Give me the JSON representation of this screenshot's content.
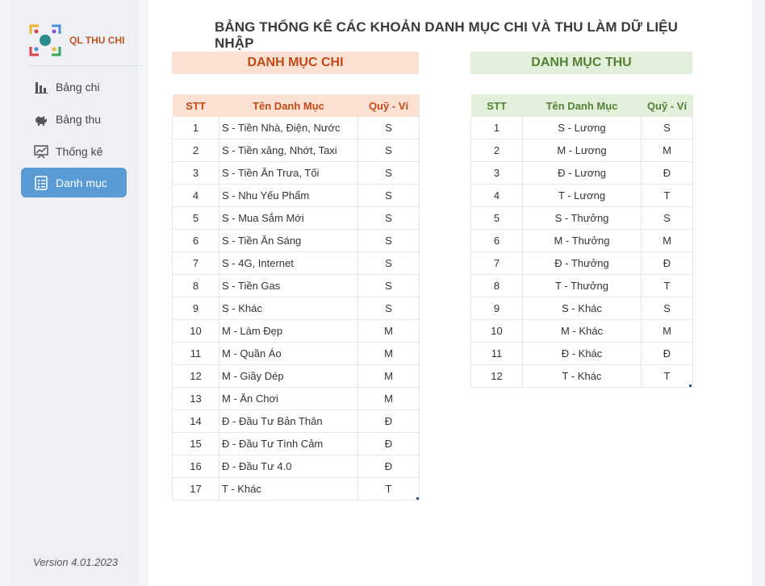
{
  "app": {
    "logo_text": "QL THU CHI",
    "version": "Version 4.01.2023"
  },
  "nav": [
    {
      "label": "Bảng chi",
      "icon": "bar-chart-icon",
      "active": false
    },
    {
      "label": "Bảng thu",
      "icon": "piggy-bank-icon",
      "active": false
    },
    {
      "label": "Thống kê",
      "icon": "presentation-chart-icon",
      "active": false
    },
    {
      "label": "Danh mục",
      "icon": "list-icon",
      "active": true
    }
  ],
  "page_title": "BẢNG THỐNG KÊ CÁC KHOẢN DANH MỤC CHI VÀ THU LÀM DỮ LIỆU NHẬP",
  "chi": {
    "title": "DANH MỤC CHI",
    "headers": [
      "STT",
      "Tên Danh Mục",
      "Quỹ - Ví"
    ],
    "rows": [
      [
        "1",
        "S - Tiền Nhà, Điện, Nước",
        "S"
      ],
      [
        "2",
        "S - Tiền xăng, Nhớt, Taxi",
        "S"
      ],
      [
        "3",
        "S - Tiền Ăn Trưa, Tối",
        "S"
      ],
      [
        "4",
        "S - Nhu Yếu Phẩm",
        "S"
      ],
      [
        "5",
        "S - Mua Sắm Mới",
        "S"
      ],
      [
        "6",
        "S - Tiền Ăn Sáng",
        "S"
      ],
      [
        "7",
        "S - 4G, Internet",
        "S"
      ],
      [
        "8",
        "S - Tiền Gas",
        "S"
      ],
      [
        "9",
        "S - Khác",
        "S"
      ],
      [
        "10",
        "M - Làm Đẹp",
        "M"
      ],
      [
        "11",
        "M - Quần Áo",
        "M"
      ],
      [
        "12",
        "M - Giầy Dép",
        "M"
      ],
      [
        "13",
        "M - Ăn Chơi",
        "M"
      ],
      [
        "14",
        "Đ - Đầu Tư Bản Thân",
        "Đ"
      ],
      [
        "15",
        "Đ - Đầu Tư Tình Cảm",
        "Đ"
      ],
      [
        "16",
        "Đ - Đầu Tư 4.0",
        "Đ"
      ],
      [
        "17",
        "T - Khác",
        "T"
      ]
    ]
  },
  "thu": {
    "title": "DANH MỤC THU",
    "headers": [
      "STT",
      "Tên Danh Mục",
      "Quỹ - Ví"
    ],
    "rows": [
      [
        "1",
        "S - Lương",
        "S"
      ],
      [
        "2",
        "M - Lương",
        "M"
      ],
      [
        "3",
        "Đ - Lương",
        "Đ"
      ],
      [
        "4",
        "T - Lương",
        "T"
      ],
      [
        "5",
        "S - Thưởng",
        "S"
      ],
      [
        "6",
        "M - Thưởng",
        "M"
      ],
      [
        "7",
        "Đ - Thưởng",
        "Đ"
      ],
      [
        "8",
        "T - Thưởng",
        "T"
      ],
      [
        "9",
        "S - Khác",
        "S"
      ],
      [
        "10",
        "M - Khác",
        "M"
      ],
      [
        "11",
        "Đ - Khác",
        "Đ"
      ],
      [
        "12",
        "T - Khác",
        "T"
      ]
    ]
  },
  "colors": {
    "chi_accent": "#c24a14",
    "chi_bg": "#fbe0d4",
    "thu_accent": "#548235",
    "thu_bg": "#e2efda",
    "active_nav": "#5b9bd5"
  }
}
